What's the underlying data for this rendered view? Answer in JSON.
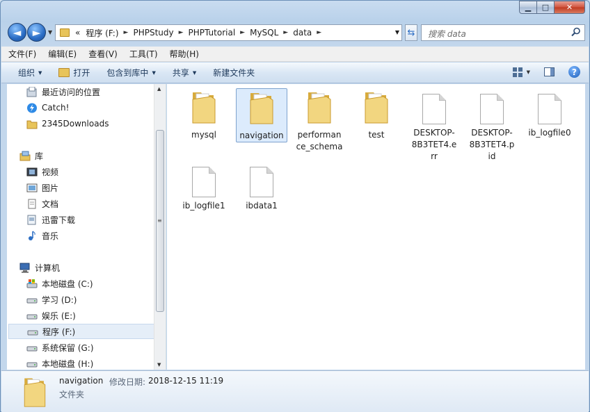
{
  "window": {
    "caption_min": "▁",
    "caption_max": "□",
    "caption_close": "✕"
  },
  "nav": {
    "back_glyph": "◄",
    "forward_glyph": "►",
    "overflow": "«",
    "breadcrumbs": [
      "程序 (F:)",
      "PHPStudy",
      "PHPTutorial",
      "MySQL",
      "data"
    ],
    "search_placeholder": "搜索 data"
  },
  "menu": [
    "文件(F)",
    "编辑(E)",
    "查看(V)",
    "工具(T)",
    "帮助(H)"
  ],
  "commands": {
    "organize": "组织",
    "open": "打开",
    "include_library": "包含到库中",
    "share": "共享",
    "new_folder": "新建文件夹",
    "help": "?"
  },
  "sidebar": {
    "items": [
      {
        "label": "最近访问的位置",
        "icon": "recent-places-icon"
      },
      {
        "label": "Catch!",
        "icon": "catch-icon"
      },
      {
        "label": "2345Downloads",
        "icon": "folder-icon"
      },
      {
        "label": "库",
        "icon": "libraries-icon"
      },
      {
        "label": "视频",
        "icon": "videos-icon"
      },
      {
        "label": "图片",
        "icon": "pictures-icon"
      },
      {
        "label": "文档",
        "icon": "documents-icon"
      },
      {
        "label": "迅雷下载",
        "icon": "thunder-download-icon"
      },
      {
        "label": "音乐",
        "icon": "music-icon"
      },
      {
        "label": "计算机",
        "icon": "computer-icon"
      },
      {
        "label": "本地磁盘 (C:)",
        "icon": "system-drive-icon"
      },
      {
        "label": "学习 (D:)",
        "icon": "drive-icon"
      },
      {
        "label": "娱乐 (E:)",
        "icon": "drive-icon"
      },
      {
        "label": "程序 (F:)",
        "icon": "drive-icon",
        "selected": true
      },
      {
        "label": "系统保留 (G:)",
        "icon": "drive-icon"
      },
      {
        "label": "本地磁盘 (H:)",
        "icon": "drive-icon"
      }
    ]
  },
  "files": [
    {
      "name": "mysql",
      "type": "folder"
    },
    {
      "name": "navigation",
      "type": "folder",
      "selected": true
    },
    {
      "name": "performance_schema",
      "type": "folder",
      "display": "performan\nce_schema"
    },
    {
      "name": "test",
      "type": "folder"
    },
    {
      "name": "DESKTOP-8B3TET4.err",
      "type": "file",
      "display": "DESKTOP-\n8B3TET4.e\nrr"
    },
    {
      "name": "DESKTOP-8B3TET4.pid",
      "type": "file",
      "display": "DESKTOP-\n8B3TET4.p\nid"
    },
    {
      "name": "ib_logfile0",
      "type": "file"
    },
    {
      "name": "ib_logfile1",
      "type": "file"
    },
    {
      "name": "ibdata1",
      "type": "file"
    }
  ],
  "details": {
    "name": "navigation",
    "date_label": "修改日期:",
    "date": "2018-12-15 11:19",
    "type": "文件夹"
  },
  "colors": {
    "folder": "#e8c45a",
    "selection": "#dcebfc",
    "accent": "#2a6cc4"
  }
}
